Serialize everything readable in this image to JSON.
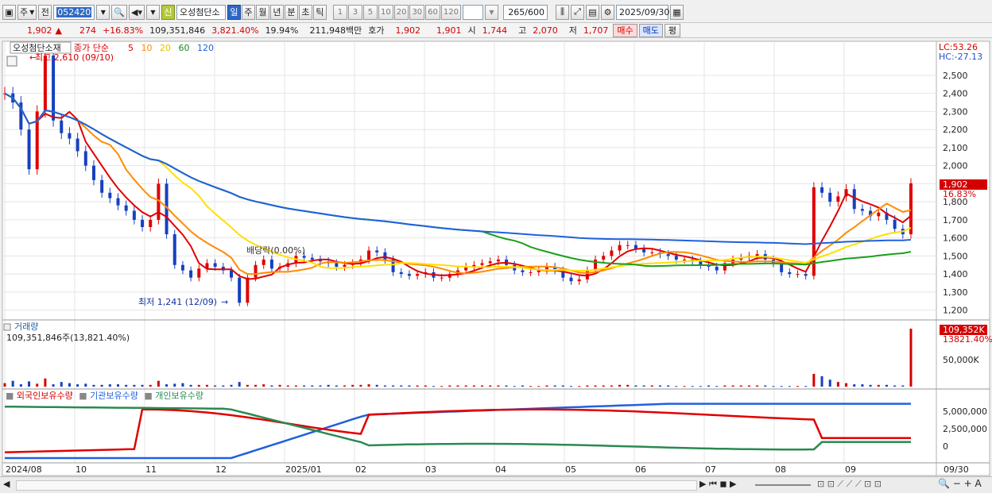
{
  "toolbar": {
    "mode": "주",
    "prev_label": "전",
    "stock_code": "052420",
    "new_badge": "신",
    "stock_name": "오성첨단소",
    "periods": [
      "일",
      "주",
      "월",
      "년",
      "분",
      "초",
      "틱"
    ],
    "active_period": "일",
    "intervals": [
      "1",
      "3",
      "5",
      "10",
      "20",
      "30",
      "60",
      "120"
    ],
    "count_value": "265",
    "count_total": "/600",
    "date": "2025/09/30"
  },
  "quote": {
    "price": "1,902",
    "change": "274",
    "change_pct": "+16.83%",
    "volume": "109,351,846",
    "vol_ratio": "3,821.40%",
    "turnover": "19.94%",
    "amount": "211,948백만",
    "ask_label": "호가",
    "ask": "1,902",
    "bid": "1,901",
    "open_label": "시",
    "open": "1,744",
    "high_label": "고",
    "high": "2,070",
    "low_label": "저",
    "low": "1,707",
    "buy_label": "매수",
    "sell_label": "매도",
    "eval_label": "평"
  },
  "price_pane": {
    "name_tag": "오성첨단소재",
    "legend_prefix": "종가 단순",
    "ma_labels": [
      "5",
      "10",
      "20",
      "60",
      "120"
    ],
    "ma_colors": [
      "#e00000",
      "#ff8c00",
      "#ffe000",
      "#1aa01a",
      "#2060e0"
    ],
    "lc": "LC:53.26",
    "hc": "HC:-27.13",
    "max_note": "최고 2,610 (09/10)",
    "min_note": "최저 1,241 (12/09)",
    "event_note": "배당락(0.00%)",
    "price_tag": "1,902",
    "pct_tag": "16.83%"
  },
  "volume_pane": {
    "title": "거래량",
    "summary": "109,351,846주(13,821.40%)",
    "tag": "109,352K",
    "tag2": "13821.40%",
    "tick": "50,000K"
  },
  "holding_pane": {
    "labels": [
      "외국인보유수량",
      "기관보유수량",
      "개인보유수량"
    ],
    "colors": [
      "#e00000",
      "#2060e0",
      "#2a8a50"
    ],
    "ticks": [
      "5,000,000",
      "2,500,000",
      "0"
    ]
  },
  "x_axis": [
    "2024/08",
    "10",
    "11",
    "12",
    "2025/01",
    "02",
    "03",
    "04",
    "05",
    "06",
    "07",
    "08",
    "09",
    "09/30"
  ],
  "chart_data": {
    "type": "candlestick",
    "y_ticks": [
      2500,
      2400,
      2300,
      2200,
      2100,
      2000,
      1900,
      1800,
      1700,
      1600,
      1500,
      1400,
      1300,
      1200
    ],
    "ylim": [
      1150,
      2680
    ],
    "close_series": [
      2400,
      2350,
      2200,
      1980,
      2300,
      2610,
      2250,
      2180,
      2150,
      2080,
      2000,
      1920,
      1850,
      1820,
      1780,
      1750,
      1700,
      1660,
      1700,
      1900,
      1620,
      1450,
      1420,
      1380,
      1430,
      1460,
      1440,
      1420,
      1380,
      1241,
      1380,
      1450,
      1480,
      1430,
      1440,
      1460,
      1500,
      1490,
      1480,
      1470,
      1460,
      1440,
      1450,
      1460,
      1480,
      1530,
      1520,
      1480,
      1410,
      1400,
      1390,
      1400,
      1410,
      1380,
      1380,
      1400,
      1420,
      1440,
      1450,
      1460,
      1470,
      1480,
      1450,
      1420,
      1410,
      1410,
      1420,
      1440,
      1420,
      1380,
      1360,
      1370,
      1420,
      1480,
      1500,
      1530,
      1560,
      1560,
      1540,
      1520,
      1520,
      1510,
      1500,
      1480,
      1480,
      1470,
      1450,
      1440,
      1420,
      1460,
      1480,
      1490,
      1500,
      1510,
      1480,
      1460,
      1410,
      1400,
      1400,
      1390,
      1880,
      1850,
      1800,
      1830,
      1870,
      1760,
      1750,
      1720,
      1740,
      1700,
      1650,
      1620,
      1902
    ],
    "volume_series": [
      6,
      10,
      4,
      9,
      5,
      14,
      4,
      8,
      6,
      4,
      5,
      3,
      3,
      4,
      4,
      3,
      3,
      3,
      3,
      10,
      4,
      5,
      6,
      3,
      3,
      3,
      2,
      2,
      3,
      8,
      3,
      3,
      4,
      2,
      3,
      2,
      2,
      2,
      2,
      2,
      3,
      2,
      2,
      3,
      3,
      4,
      3,
      2,
      2,
      2,
      2,
      2,
      2,
      1,
      1,
      2,
      2,
      2,
      2,
      2,
      2,
      2,
      2,
      1,
      2,
      1,
      1,
      2,
      2,
      2,
      1,
      1,
      2,
      2,
      2,
      2,
      3,
      3,
      2,
      2,
      2,
      2,
      2,
      1,
      1,
      1,
      1,
      2,
      1,
      2,
      2,
      2,
      2,
      2,
      2,
      1,
      1,
      1,
      1,
      1,
      22,
      18,
      12,
      8,
      6,
      4,
      4,
      3,
      3,
      3,
      2,
      2,
      100
    ]
  }
}
